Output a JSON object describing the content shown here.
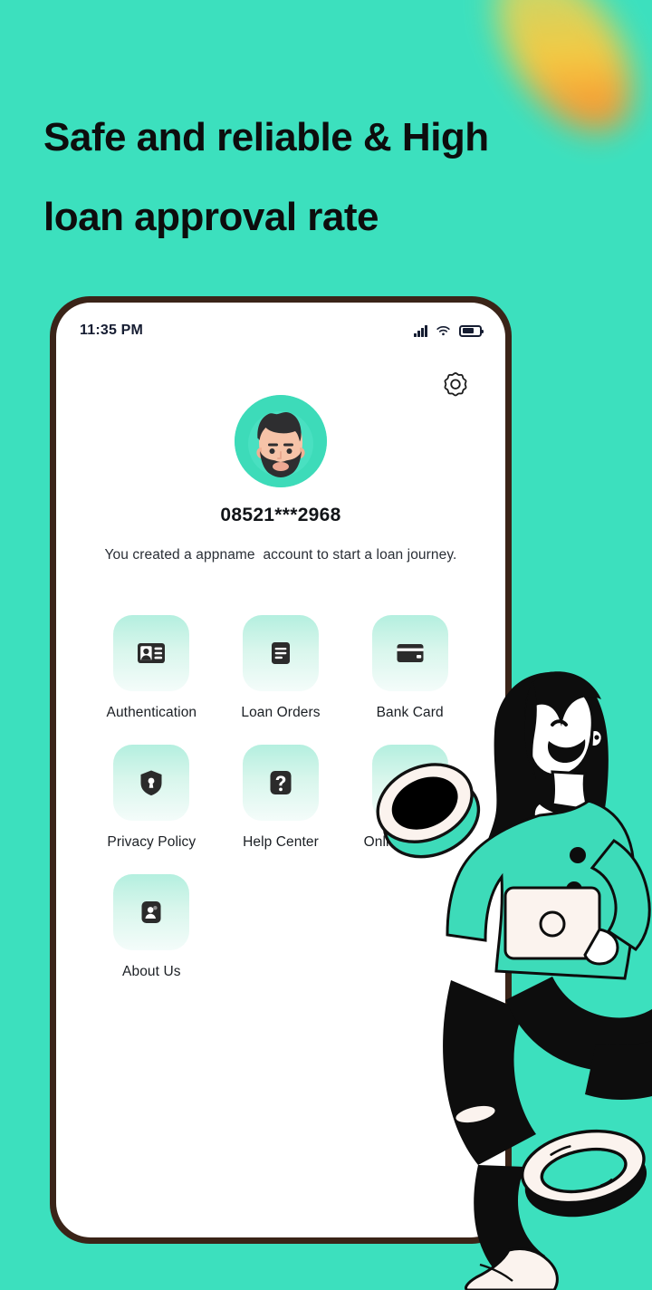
{
  "theme": {
    "background": "#3ce0be",
    "bezel": "#3a2418",
    "screen": "#ffffff",
    "accent": "#3ddbb9",
    "tile_gradient_top": "#b4efdf",
    "tile_gradient_bottom": "#f4fcfa",
    "icon_dark": "#2b2b2b",
    "text_dark": "#111418",
    "blob_colors": [
      "#9fe08a",
      "#d9d45e",
      "#ffc93c",
      "#ff9b2f",
      "#ff8a1f"
    ]
  },
  "headline": {
    "line1": "Safe and reliable & High",
    "line2": "loan approval rate"
  },
  "statusbar": {
    "time": "11:35 PM",
    "signal_icon": "signal-bars-icon",
    "wifi_icon": "wifi-icon",
    "battery_icon": "battery-icon",
    "battery_level": 70
  },
  "header": {
    "settings_icon": "gear-icon"
  },
  "profile": {
    "avatar_icon": "user-avatar-bearded-man",
    "phone_number": "08521***2968",
    "tagline": "You created a appname  account to start a loan journey."
  },
  "menu": {
    "items": [
      {
        "label": "Authentication",
        "icon": "id-card-icon"
      },
      {
        "label": "Loan Orders",
        "icon": "document-lines-icon"
      },
      {
        "label": "Bank Card",
        "icon": "credit-card-icon"
      },
      {
        "label": "Privacy Policy",
        "icon": "shield-lock-icon"
      },
      {
        "label": "Help Center",
        "icon": "question-mark-icon"
      },
      {
        "label": "Online Service",
        "icon": "headset-support-icon"
      },
      {
        "label": "About Us",
        "icon": "person-badge-icon"
      }
    ]
  },
  "illustration": {
    "woman_figure": "woman-with-laptop-illustration",
    "ring_top": "teal-ring-illustration",
    "ring_bottom": "white-ring-illustration"
  }
}
